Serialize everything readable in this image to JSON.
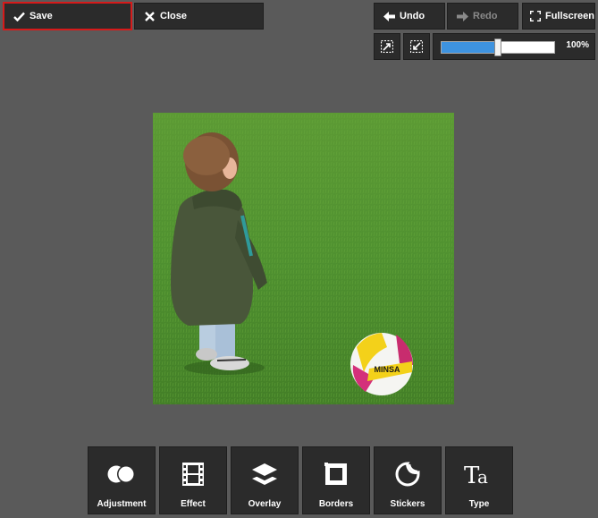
{
  "toolbar": {
    "save_label": "Save",
    "close_label": "Close",
    "undo_label": "Undo",
    "redo_label": "Redo",
    "fullscreen_label": "Fullscreen"
  },
  "zoom": {
    "label": "100%",
    "slider_level": 0.5
  },
  "tools": [
    {
      "label": "Adjustment",
      "icon": "adjustment-icon"
    },
    {
      "label": "Effect",
      "icon": "film-icon"
    },
    {
      "label": "Overlay",
      "icon": "layers-icon"
    },
    {
      "label": "Borders",
      "icon": "frame-icon"
    },
    {
      "label": "Stickers",
      "icon": "sticker-icon"
    },
    {
      "label": "Type",
      "icon": "text-icon"
    }
  ],
  "photo": {
    "ball_text": "MINSA"
  },
  "colors": {
    "background": "#5a5a5a",
    "button": "#2b2b2b",
    "save_highlight": "#d61a1a",
    "slider_fill": "#3e93e0"
  }
}
